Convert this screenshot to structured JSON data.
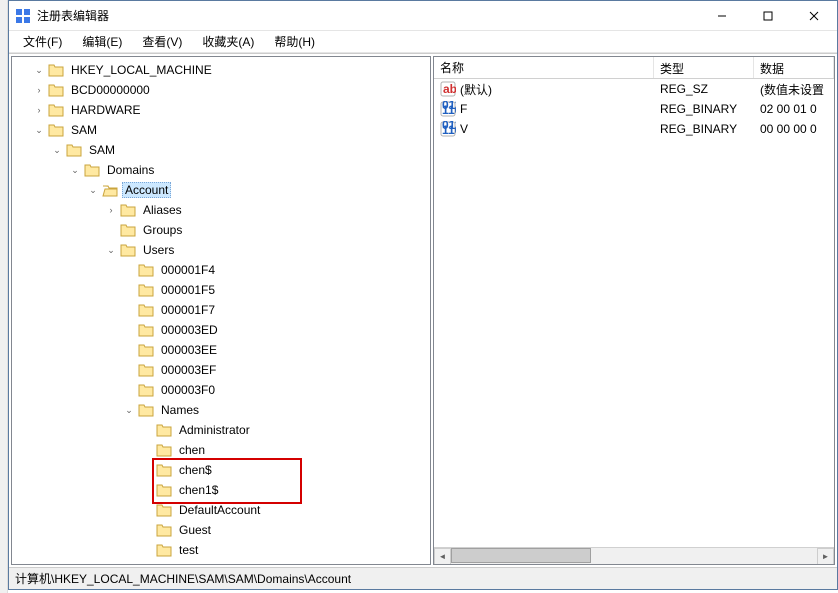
{
  "window": {
    "title": "注册表编辑器"
  },
  "menu": {
    "file": "文件(F)",
    "edit": "编辑(E)",
    "view": "查看(V)",
    "favorites": "收藏夹(A)",
    "help": "帮助(H)"
  },
  "tree": {
    "root": "HKEY_LOCAL_MACHINE",
    "bcd": "BCD00000000",
    "hardware": "HARDWARE",
    "sam": "SAM",
    "sam2": "SAM",
    "domains": "Domains",
    "account": "Account",
    "aliases": "Aliases",
    "groups": "Groups",
    "users": "Users",
    "u1": "000001F4",
    "u2": "000001F5",
    "u3": "000001F7",
    "u4": "000003ED",
    "u5": "000003EE",
    "u6": "000003EF",
    "u7": "000003F0",
    "names": "Names",
    "n1": "Administrator",
    "n2": "chen",
    "n3": "chen$",
    "n4": "chen1$",
    "n5": "DefaultAccount",
    "n6": "Guest",
    "n7": "test"
  },
  "list": {
    "headers": {
      "name": "名称",
      "type": "类型",
      "data": "数据"
    },
    "rows": [
      {
        "icon": "string",
        "name": "(默认)",
        "type": "REG_SZ",
        "data": "(数值未设置"
      },
      {
        "icon": "binary",
        "name": "F",
        "type": "REG_BINARY",
        "data": "02 00 01 0"
      },
      {
        "icon": "binary",
        "name": "V",
        "type": "REG_BINARY",
        "data": "00 00 00 0"
      }
    ]
  },
  "statusbar": {
    "path": "计算机\\HKEY_LOCAL_MACHINE\\SAM\\SAM\\Domains\\Account"
  },
  "icons": {
    "expanded": "⌄",
    "collapsed": "›"
  }
}
